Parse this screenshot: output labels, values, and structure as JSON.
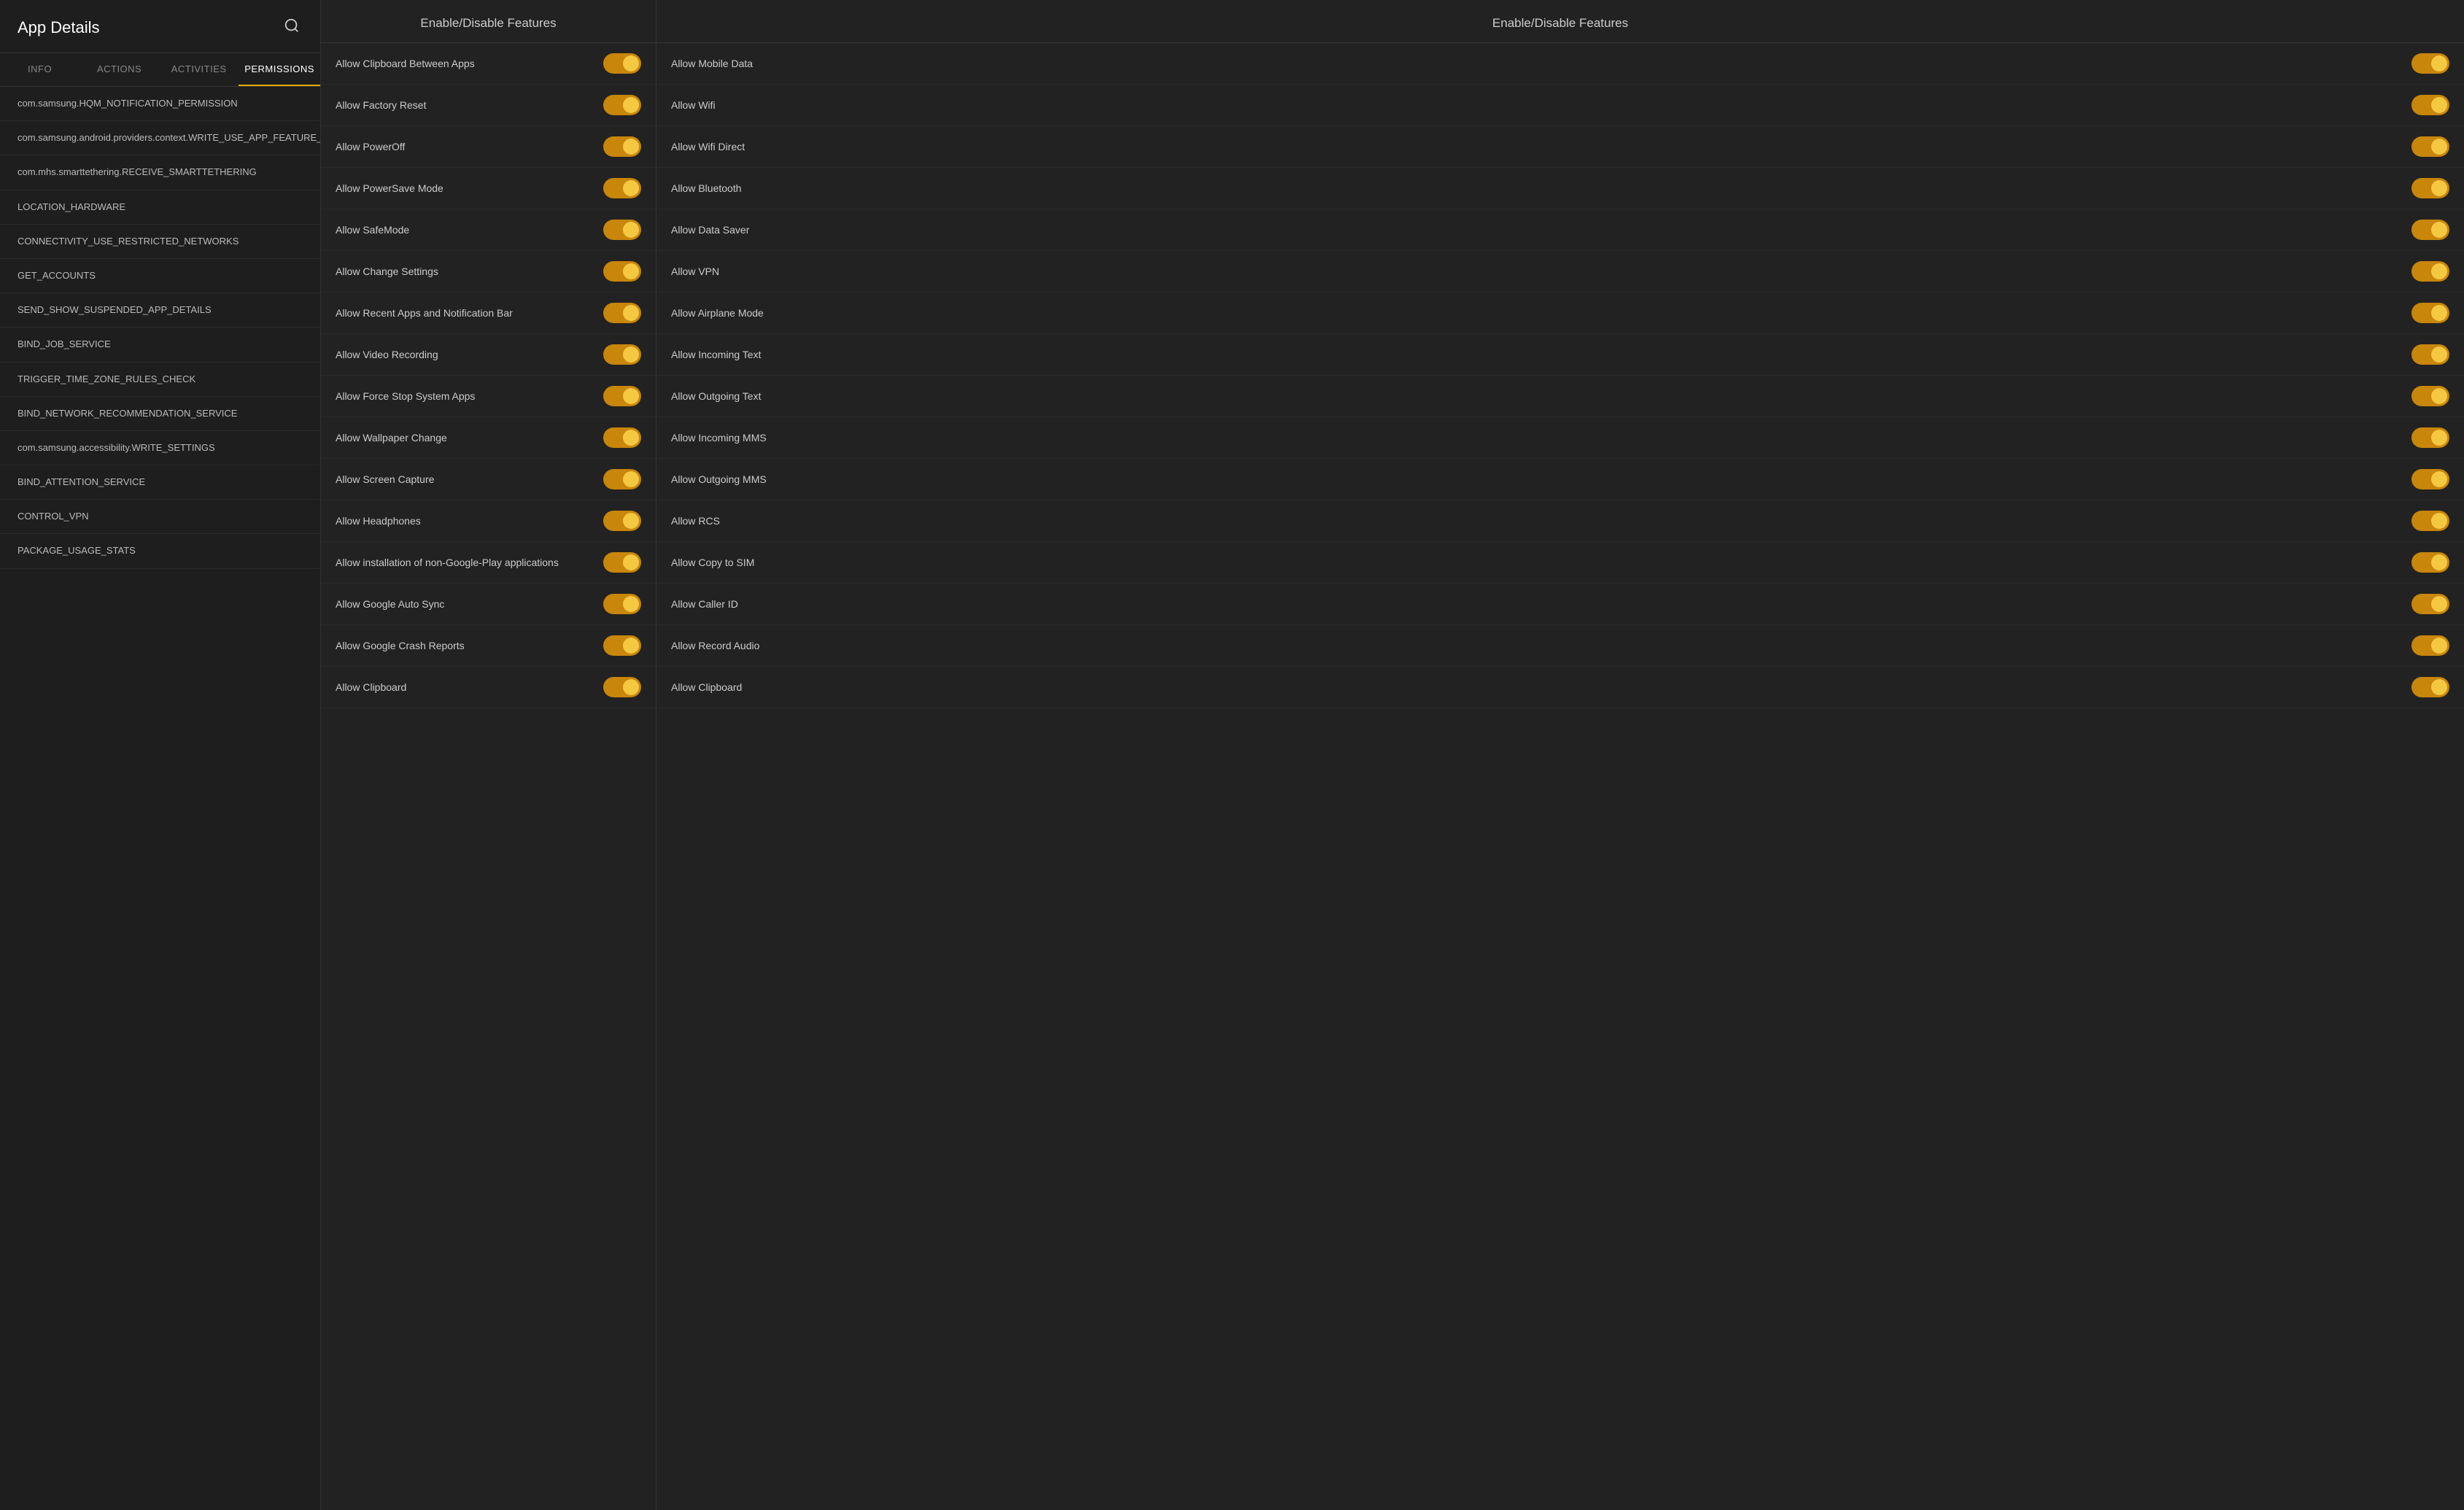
{
  "leftPanel": {
    "title": "App Details",
    "tabs": [
      {
        "label": "INFO",
        "active": false
      },
      {
        "label": "ACTIONS",
        "active": false
      },
      {
        "label": "ACTIVITIES",
        "active": false
      },
      {
        "label": "PERMISSIONS",
        "active": true
      }
    ],
    "permissions": [
      "com.samsung.HQM_NOTIFICATION_PERMISSION",
      "com.samsung.android.providers.context.WRITE_USE_APP_FEATURE_SURVEY",
      "com.mhs.smarttethering.RECEIVE_SMARTTETHERING",
      "LOCATION_HARDWARE",
      "CONNECTIVITY_USE_RESTRICTED_NETWORKS",
      "GET_ACCOUNTS",
      "SEND_SHOW_SUSPENDED_APP_DETAILS",
      "BIND_JOB_SERVICE",
      "TRIGGER_TIME_ZONE_RULES_CHECK",
      "BIND_NETWORK_RECOMMENDATION_SERVICE",
      "com.samsung.accessibility.WRITE_SETTINGS",
      "BIND_ATTENTION_SERVICE",
      "CONTROL_VPN",
      "PACKAGE_USAGE_STATS"
    ]
  },
  "middlePanel": {
    "header": "Enable/Disable Features",
    "features": [
      {
        "label": "Allow Clipboard Between Apps",
        "on": true
      },
      {
        "label": "Allow Factory Reset",
        "on": true
      },
      {
        "label": "Allow PowerOff",
        "on": true
      },
      {
        "label": "Allow PowerSave Mode",
        "on": true
      },
      {
        "label": "Allow SafeMode",
        "on": true
      },
      {
        "label": "Allow Change Settings",
        "on": true
      },
      {
        "label": "Allow Recent Apps and Notification Bar",
        "on": true
      },
      {
        "label": "Allow Video Recording",
        "on": true
      },
      {
        "label": "Allow Force Stop System Apps",
        "on": true
      },
      {
        "label": "Allow Wallpaper Change",
        "on": true
      },
      {
        "label": "Allow Screen Capture",
        "on": true
      },
      {
        "label": "Allow Headphones",
        "on": true
      },
      {
        "label": "Allow installation of non-Google-Play applications",
        "on": true
      },
      {
        "label": "Allow Google Auto Sync",
        "on": true
      },
      {
        "label": "Allow Google Crash Reports",
        "on": true
      },
      {
        "label": "Allow Clipboard",
        "on": true
      }
    ]
  },
  "rightPanel": {
    "header": "Enable/Disable Features",
    "features": [
      {
        "label": "Allow Mobile Data",
        "on": true
      },
      {
        "label": "Allow Wifi",
        "on": true
      },
      {
        "label": "Allow Wifi Direct",
        "on": true
      },
      {
        "label": "Allow Bluetooth",
        "on": true
      },
      {
        "label": "Allow Data Saver",
        "on": true
      },
      {
        "label": "Allow VPN",
        "on": true
      },
      {
        "label": "Allow Airplane Mode",
        "on": true
      },
      {
        "label": "Allow Incoming Text",
        "on": true
      },
      {
        "label": "Allow Outgoing Text",
        "on": true
      },
      {
        "label": "Allow Incoming MMS",
        "on": true
      },
      {
        "label": "Allow Outgoing MMS",
        "on": true
      },
      {
        "label": "Allow RCS",
        "on": true
      },
      {
        "label": "Allow Copy to SIM",
        "on": true
      },
      {
        "label": "Allow Caller ID",
        "on": true
      },
      {
        "label": "Allow Record Audio",
        "on": true
      },
      {
        "label": "Allow Clipboard",
        "on": true
      }
    ]
  }
}
